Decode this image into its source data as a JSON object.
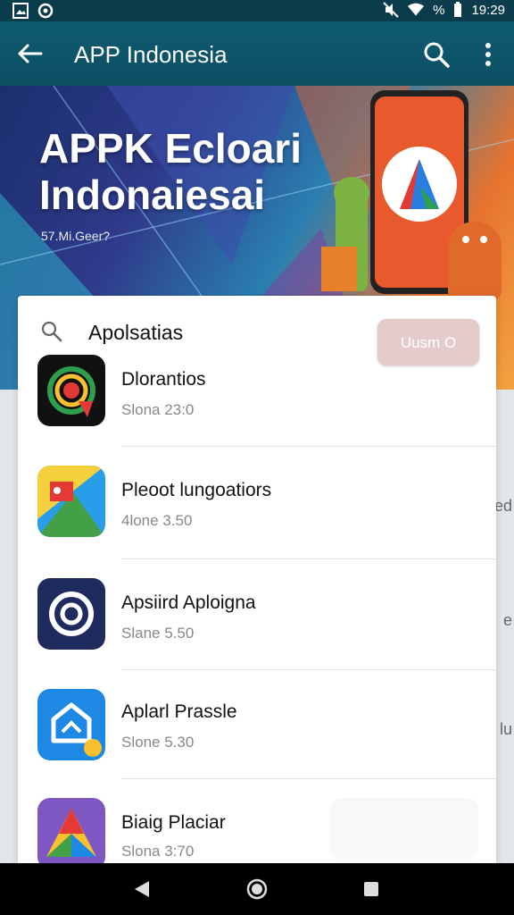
{
  "status_bar": {
    "battery_text": "%",
    "time": "19:29"
  },
  "app_bar": {
    "title": "APP Indonesia",
    "icons": [
      "back-arrow-icon",
      "search-icon",
      "more-vert-icon"
    ]
  },
  "banner": {
    "title_line1": "APPK Ecloari",
    "title_line2": "Indonaiesai",
    "subtitle": "57.Mi.Geer?"
  },
  "card": {
    "search_label": "Apolsatias",
    "button_label": "Uusm O",
    "items": [
      {
        "name": "Dlorantios",
        "meta": "Slona 23:0"
      },
      {
        "name": "Pleoot lungoatiors",
        "meta": "4lone 3.50"
      },
      {
        "name": "Apsiird Aploigna",
        "meta": "Slane 5.50"
      },
      {
        "name": "Aplarl Prassle",
        "meta": "Slone 5.30"
      },
      {
        "name": "Biaig Placiar",
        "meta": "Slona 3:70"
      }
    ]
  },
  "right_edge": [
    "ed",
    "e",
    "lu"
  ],
  "colors": {
    "app_bar": "#0f5a70",
    "status_bar": "#0b3c4c",
    "chip": "#e4cbcc"
  }
}
